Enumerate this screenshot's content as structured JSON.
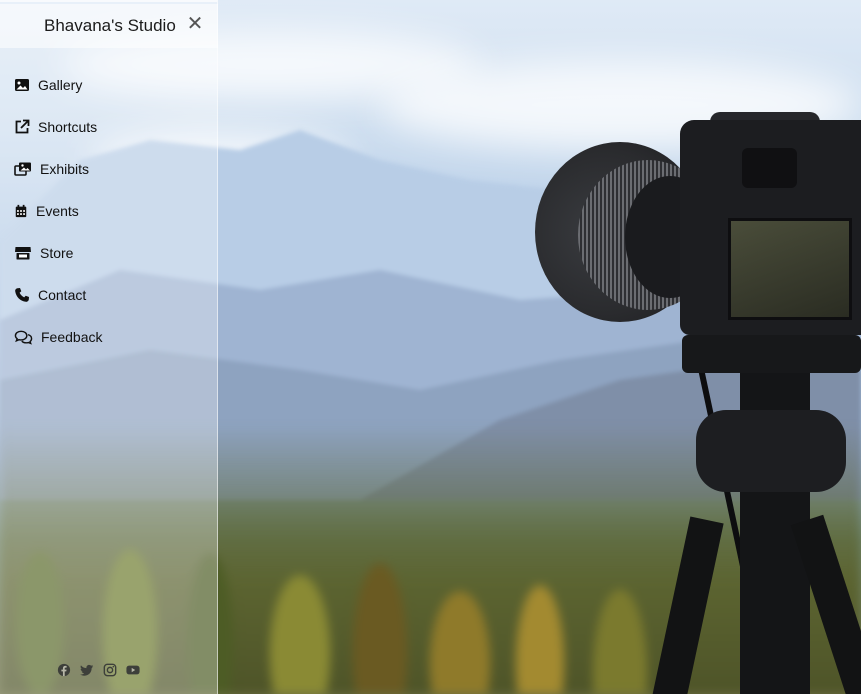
{
  "sidebar": {
    "brand": "Bhavana's Studio",
    "close_icon": "close-icon",
    "items": [
      {
        "label": "Gallery",
        "icon": "image-icon"
      },
      {
        "label": "Shortcuts",
        "icon": "external-link-icon"
      },
      {
        "label": "Exhibits",
        "icon": "images-icon"
      },
      {
        "label": "Events",
        "icon": "calendar-icon"
      },
      {
        "label": "Store",
        "icon": "store-icon"
      },
      {
        "label": "Contact",
        "icon": "phone-icon"
      },
      {
        "label": "Feedback",
        "icon": "comments-icon"
      }
    ],
    "socials": [
      "facebook-icon",
      "twitter-icon",
      "instagram-icon",
      "youtube-icon"
    ]
  },
  "colors": {
    "text": "#111111",
    "sidebar_bg": "rgba(255,255,255,0.30)"
  }
}
